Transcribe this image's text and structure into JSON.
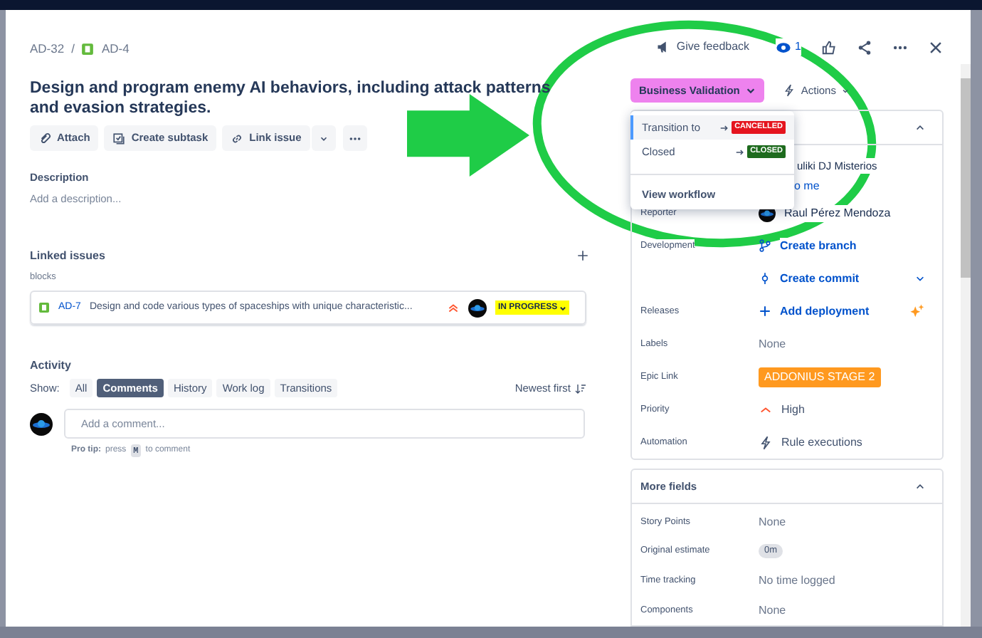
{
  "breadcrumb": {
    "parent": "AD-32",
    "separator": "/",
    "issue": "AD-4"
  },
  "header_actions": {
    "feedback": "Give feedback",
    "watchers": "1"
  },
  "title": "Design and program enemy AI behaviors, including attack patterns and evasion strategies.",
  "toolbar": [
    {
      "label": "Attach",
      "kind": "attach"
    },
    {
      "label": "Create subtask",
      "kind": "subtask"
    },
    {
      "label": "Link issue",
      "kind": "link"
    }
  ],
  "description": {
    "label": "Description",
    "placeholder": "Add a description..."
  },
  "linked_issues": {
    "title": "Linked issues",
    "relation": "blocks",
    "items": [
      {
        "key": "AD-7",
        "summary": "Design and code various types of spaceships with unique characteristic...",
        "status": "IN PROGRESS"
      }
    ]
  },
  "activity": {
    "title": "Activity",
    "show_label": "Show:",
    "filters": [
      {
        "label": "All",
        "selected": false
      },
      {
        "label": "Comments",
        "selected": true
      },
      {
        "label": "History",
        "selected": false
      },
      {
        "label": "Work log",
        "selected": false
      },
      {
        "label": "Transitions",
        "selected": false
      }
    ],
    "sort": "Newest first",
    "comment_placeholder": "Add a comment...",
    "tip_label": "Pro tip:",
    "tip_before": "press",
    "tip_key": "M",
    "tip_after": "to comment"
  },
  "status": {
    "label": "Business Validation"
  },
  "actions": "Actions",
  "transition_menu": {
    "items": [
      {
        "label": "Transition to",
        "target": "CANCELLED",
        "color": "#e5141e",
        "selected": true
      },
      {
        "label": "Closed",
        "target": "CLOSED",
        "color": "#1e6b1e",
        "selected": false
      }
    ],
    "footer": "View workflow"
  },
  "details": {
    "assignee_name": "uliki DJ Misterios",
    "assign_to_me": "o me",
    "fields": [
      {
        "label": "Reporter",
        "kind": "person",
        "values": [
          "Raul Pérez Mendoza"
        ]
      },
      {
        "label": "Development",
        "kind": "development",
        "values": [
          "Create branch",
          "Create commit"
        ]
      },
      {
        "label": "Releases",
        "kind": "release",
        "values": [
          "Add deployment"
        ]
      },
      {
        "label": "Labels",
        "kind": "none",
        "values": [
          "None"
        ]
      },
      {
        "label": "Epic Link",
        "kind": "tag",
        "values": [
          "ADDONIUS STAGE 2"
        ]
      },
      {
        "label": "Priority",
        "kind": "priority",
        "values": [
          "High"
        ]
      },
      {
        "label": "Automation",
        "kind": "automation",
        "values": [
          "Rule executions"
        ]
      }
    ]
  },
  "more_fields": {
    "title": "More fields",
    "fields": [
      {
        "label": "Story Points",
        "kind": "none",
        "values": [
          "None"
        ]
      },
      {
        "label": "Original estimate",
        "kind": "pill",
        "values": [
          "0m"
        ]
      },
      {
        "label": "Time tracking",
        "kind": "text",
        "values": [
          "No time logged"
        ]
      },
      {
        "label": "Components",
        "kind": "none",
        "values": [
          "None"
        ]
      }
    ]
  },
  "annotations": [
    {
      "kind": "arrow"
    },
    {
      "kind": "ellipse"
    }
  ]
}
